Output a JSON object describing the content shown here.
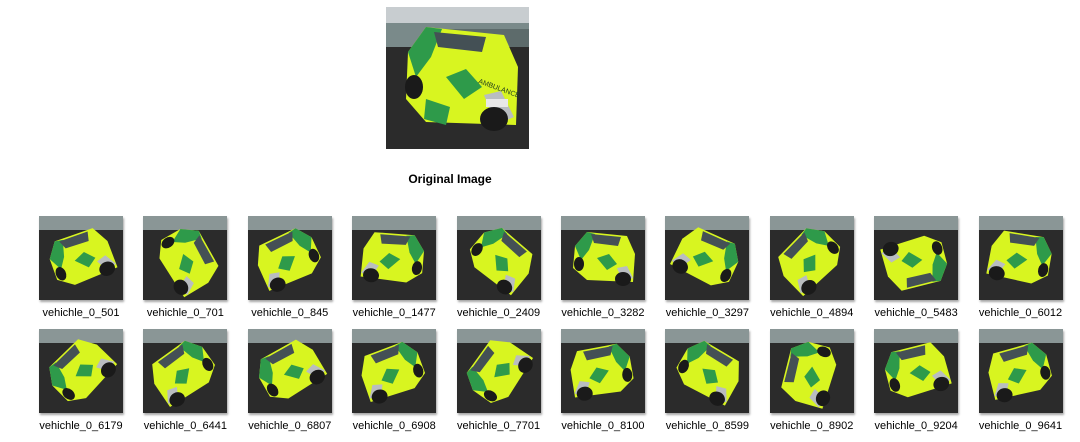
{
  "original": {
    "caption": "Original Image"
  },
  "colors": {
    "body_yellow": "#d8f520",
    "body_green": "#2e9a4a",
    "body_silver": "#b9bdc0",
    "ground": "#2b2b2b",
    "background": "#ffffff"
  },
  "thumbnails": [
    {
      "label": "vehichle_0_501",
      "rotation": -25,
      "flip": false
    },
    {
      "label": "vehichle_0_701",
      "rotation": 55,
      "flip": false
    },
    {
      "label": "vehichle_0_845",
      "rotation": 20,
      "flip": true
    },
    {
      "label": "vehichle_0_1477",
      "rotation": -10,
      "flip": true
    },
    {
      "label": "vehichle_0_2409",
      "rotation": 35,
      "flip": false
    },
    {
      "label": "vehichle_0_3282",
      "rotation": 0,
      "flip": false
    },
    {
      "label": "vehichle_0_3297",
      "rotation": -30,
      "flip": true
    },
    {
      "label": "vehichle_0_4894",
      "rotation": 40,
      "flip": true
    },
    {
      "label": "vehichle_0_5483",
      "rotation": 160,
      "flip": false
    },
    {
      "label": "vehichle_0_6012",
      "rotation": -15,
      "flip": true
    },
    {
      "label": "vehichle_0_6179",
      "rotation": -50,
      "flip": false
    },
    {
      "label": "vehichle_0_6441",
      "rotation": 30,
      "flip": true
    },
    {
      "label": "vehichle_0_6807",
      "rotation": -35,
      "flip": false
    },
    {
      "label": "vehichle_0_6908",
      "rotation": 15,
      "flip": true
    },
    {
      "label": "vehichle_0_7701",
      "rotation": -60,
      "flip": false
    },
    {
      "label": "vehichle_0_8100",
      "rotation": 5,
      "flip": true
    },
    {
      "label": "vehichle_0_8599",
      "rotation": 25,
      "flip": false
    },
    {
      "label": "vehichle_0_8902",
      "rotation": 70,
      "flip": true
    },
    {
      "label": "vehichle_0_9204",
      "rotation": -20,
      "flip": false
    },
    {
      "label": "vehichle_0_9641",
      "rotation": 10,
      "flip": true
    }
  ]
}
